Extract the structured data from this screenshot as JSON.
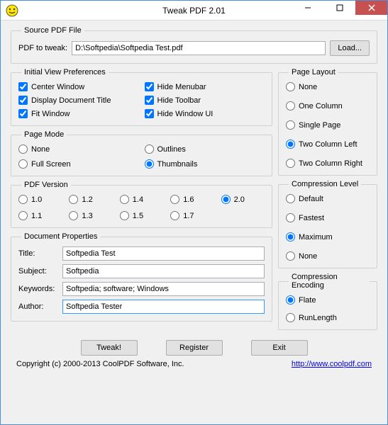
{
  "window": {
    "title": "Tweak PDF 2.01"
  },
  "source": {
    "legend": "Source PDF File",
    "label": "PDF to tweak:",
    "path": "D:\\Softpedia\\Softpedia Test.pdf",
    "load_btn": "Load..."
  },
  "initial_view": {
    "legend": "Initial View Preferences",
    "items": [
      {
        "label": "Center Window",
        "checked": true
      },
      {
        "label": "Hide Menubar",
        "checked": true
      },
      {
        "label": "Display Document Title",
        "checked": true
      },
      {
        "label": "Hide Toolbar",
        "checked": true
      },
      {
        "label": "Fit Window",
        "checked": true
      },
      {
        "label": "Hide Window UI",
        "checked": true
      }
    ]
  },
  "page_mode": {
    "legend": "Page Mode",
    "items": [
      {
        "label": "None",
        "checked": false
      },
      {
        "label": "Outlines",
        "checked": false
      },
      {
        "label": "Full Screen",
        "checked": false
      },
      {
        "label": "Thumbnails",
        "checked": true
      }
    ]
  },
  "pdf_version": {
    "legend": "PDF Version",
    "items": [
      {
        "label": "1.0",
        "checked": false
      },
      {
        "label": "1.2",
        "checked": false
      },
      {
        "label": "1.4",
        "checked": false
      },
      {
        "label": "1.6",
        "checked": false
      },
      {
        "label": "2.0",
        "checked": true
      },
      {
        "label": "1.1",
        "checked": false
      },
      {
        "label": "1.3",
        "checked": false
      },
      {
        "label": "1.5",
        "checked": false
      },
      {
        "label": "1.7",
        "checked": false
      }
    ]
  },
  "doc_props": {
    "legend": "Document Properties",
    "title_label": "Title:",
    "title_value": "Softpedia Test",
    "subject_label": "Subject:",
    "subject_value": "Softpedia",
    "keywords_label": "Keywords:",
    "keywords_value": "Softpedia; software; Windows",
    "author_label": "Author:",
    "author_value": "Softpedia Tester"
  },
  "page_layout": {
    "legend": "Page Layout",
    "items": [
      {
        "label": "None",
        "checked": false
      },
      {
        "label": "One Column",
        "checked": false
      },
      {
        "label": "Single Page",
        "checked": false
      },
      {
        "label": "Two Column Left",
        "checked": true
      },
      {
        "label": "Two Column Right",
        "checked": false
      }
    ]
  },
  "compression_level": {
    "legend": "Compression Level",
    "items": [
      {
        "label": "Default",
        "checked": false
      },
      {
        "label": "Fastest",
        "checked": false
      },
      {
        "label": "Maximum",
        "checked": true
      },
      {
        "label": "None",
        "checked": false
      }
    ]
  },
  "compression_encoding": {
    "legend": "Compression Encoding",
    "items": [
      {
        "label": "Flate",
        "checked": true
      },
      {
        "label": "RunLength",
        "checked": false
      }
    ]
  },
  "buttons": {
    "tweak": "Tweak!",
    "register": "Register",
    "exit": "Exit"
  },
  "footer": {
    "copyright": "Copyright (c) 2000-2013 CoolPDF Software, Inc.",
    "url": "http://www.coolpdf.com"
  }
}
